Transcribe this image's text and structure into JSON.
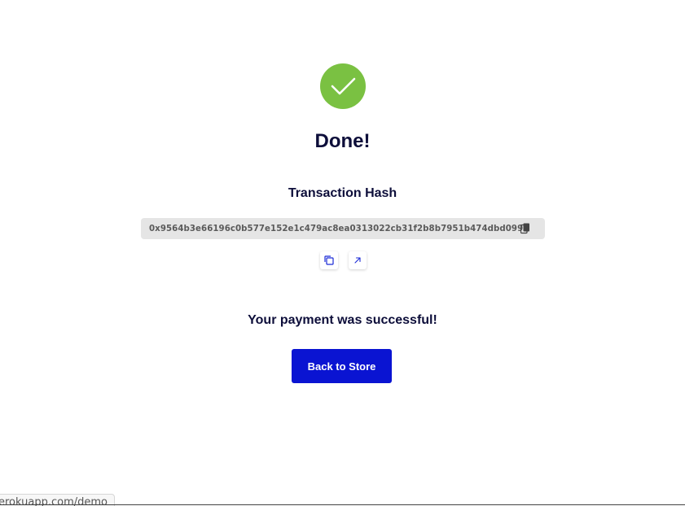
{
  "success": {
    "icon": "checkmark-icon",
    "color": "#7ac142",
    "title": "Done!"
  },
  "transaction": {
    "label": "Transaction Hash",
    "hash": "0x9564b3e66196c0b577e152e1c479ac8ea0313022cb31f2b8b7951b474dbd0991",
    "copy_icon": "clipboard-icon"
  },
  "actions": {
    "copy_icon": "copy-icon",
    "open_icon": "external-link-icon"
  },
  "message": "Your payment was successful!",
  "back_button": {
    "label": "Back to Store",
    "color": "#0a14d2"
  },
  "status_bar": {
    "url": "erokuapp.com/demo"
  }
}
